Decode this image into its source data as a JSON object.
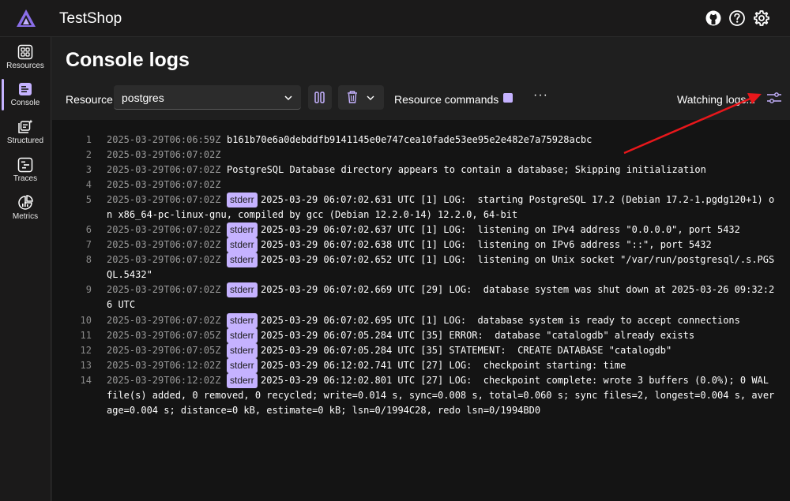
{
  "header": {
    "title": "TestShop",
    "icons": [
      "github-icon",
      "help-icon",
      "settings-icon"
    ]
  },
  "nav": {
    "items": [
      {
        "label": "Resources",
        "icon": "resources-icon",
        "active": false
      },
      {
        "label": "Console",
        "icon": "console-icon",
        "active": true
      },
      {
        "label": "Structured",
        "icon": "structured-icon",
        "active": false
      },
      {
        "label": "Traces",
        "icon": "traces-icon",
        "active": false
      },
      {
        "label": "Metrics",
        "icon": "metrics-icon",
        "active": false
      }
    ]
  },
  "page": {
    "title": "Console logs"
  },
  "toolbar": {
    "resource_label": "Resource",
    "resource_value": "postgres",
    "resource_commands_label": "Resource commands",
    "more_label": "···",
    "status": "Watching logs..."
  },
  "logs": [
    {
      "n": "1",
      "ts": "2025-03-29T06:06:59Z",
      "badge": "",
      "msg": "b161b70e6a0debddfb9141145e0e747cea10fade53ee95e2e482e7a75928acbc",
      "cont": ""
    },
    {
      "n": "2",
      "ts": "2025-03-29T06:07:02Z",
      "badge": "",
      "msg": "",
      "cont": ""
    },
    {
      "n": "3",
      "ts": "2025-03-29T06:07:02Z",
      "badge": "",
      "msg": "PostgreSQL Database directory appears to contain a database; Skipping initialization",
      "cont": ""
    },
    {
      "n": "4",
      "ts": "2025-03-29T06:07:02Z",
      "badge": "",
      "msg": "",
      "cont": ""
    },
    {
      "n": "5",
      "ts": "2025-03-29T06:07:02Z",
      "badge": "stderr",
      "msg": "2025-03-29 06:07:02.631 UTC [1] LOG:  starting PostgreSQL 17.2 (Debian 17.2-1.pgdg120+1) o",
      "cont": "n x86_64-pc-linux-gnu, compiled by gcc (Debian 12.2.0-14) 12.2.0, 64-bit"
    },
    {
      "n": "6",
      "ts": "2025-03-29T06:07:02Z",
      "badge": "stderr",
      "msg": "2025-03-29 06:07:02.637 UTC [1] LOG:  listening on IPv4 address \"0.0.0.0\", port 5432",
      "cont": ""
    },
    {
      "n": "7",
      "ts": "2025-03-29T06:07:02Z",
      "badge": "stderr",
      "msg": "2025-03-29 06:07:02.638 UTC [1] LOG:  listening on IPv6 address \"::\", port 5432",
      "cont": ""
    },
    {
      "n": "8",
      "ts": "2025-03-29T06:07:02Z",
      "badge": "stderr",
      "msg": "2025-03-29 06:07:02.652 UTC [1] LOG:  listening on Unix socket \"/var/run/postgresql/.s.PGS",
      "cont": "QL.5432\""
    },
    {
      "n": "9",
      "ts": "2025-03-29T06:07:02Z",
      "badge": "stderr",
      "msg": "2025-03-29 06:07:02.669 UTC [29] LOG:  database system was shut down at 2025-03-26 09:32:2",
      "cont": "6 UTC"
    },
    {
      "n": "10",
      "ts": "2025-03-29T06:07:02Z",
      "badge": "stderr",
      "msg": "2025-03-29 06:07:02.695 UTC [1] LOG:  database system is ready to accept connections",
      "cont": ""
    },
    {
      "n": "11",
      "ts": "2025-03-29T06:07:05Z",
      "badge": "stderr",
      "msg": "2025-03-29 06:07:05.284 UTC [35] ERROR:  database \"catalogdb\" already exists",
      "cont": ""
    },
    {
      "n": "12",
      "ts": "2025-03-29T06:07:05Z",
      "badge": "stderr",
      "msg": "2025-03-29 06:07:05.284 UTC [35] STATEMENT:  CREATE DATABASE \"catalogdb\"",
      "cont": ""
    },
    {
      "n": "13",
      "ts": "2025-03-29T06:12:02Z",
      "badge": "stderr",
      "msg": "2025-03-29 06:12:02.741 UTC [27] LOG:  checkpoint starting: time",
      "cont": ""
    },
    {
      "n": "14",
      "ts": "2025-03-29T06:12:02Z",
      "badge": "stderr",
      "msg": "2025-03-29 06:12:02.801 UTC [27] LOG:  checkpoint complete: wrote 3 buffers (0.0%); 0 WAL",
      "cont": "file(s) added, 0 removed, 0 recycled; write=0.014 s, sync=0.008 s, total=0.060 s; sync files=2, longest=0.004 s, aver\nage=0.004 s; distance=0 kB, estimate=0 kB; lsn=0/1994C28, redo lsn=0/1994BD0"
    }
  ],
  "colors": {
    "accent": "#c5b2ff",
    "annotation_arrow": "#e8171b",
    "background": "#1f1f1f",
    "log_background": "#141414"
  }
}
